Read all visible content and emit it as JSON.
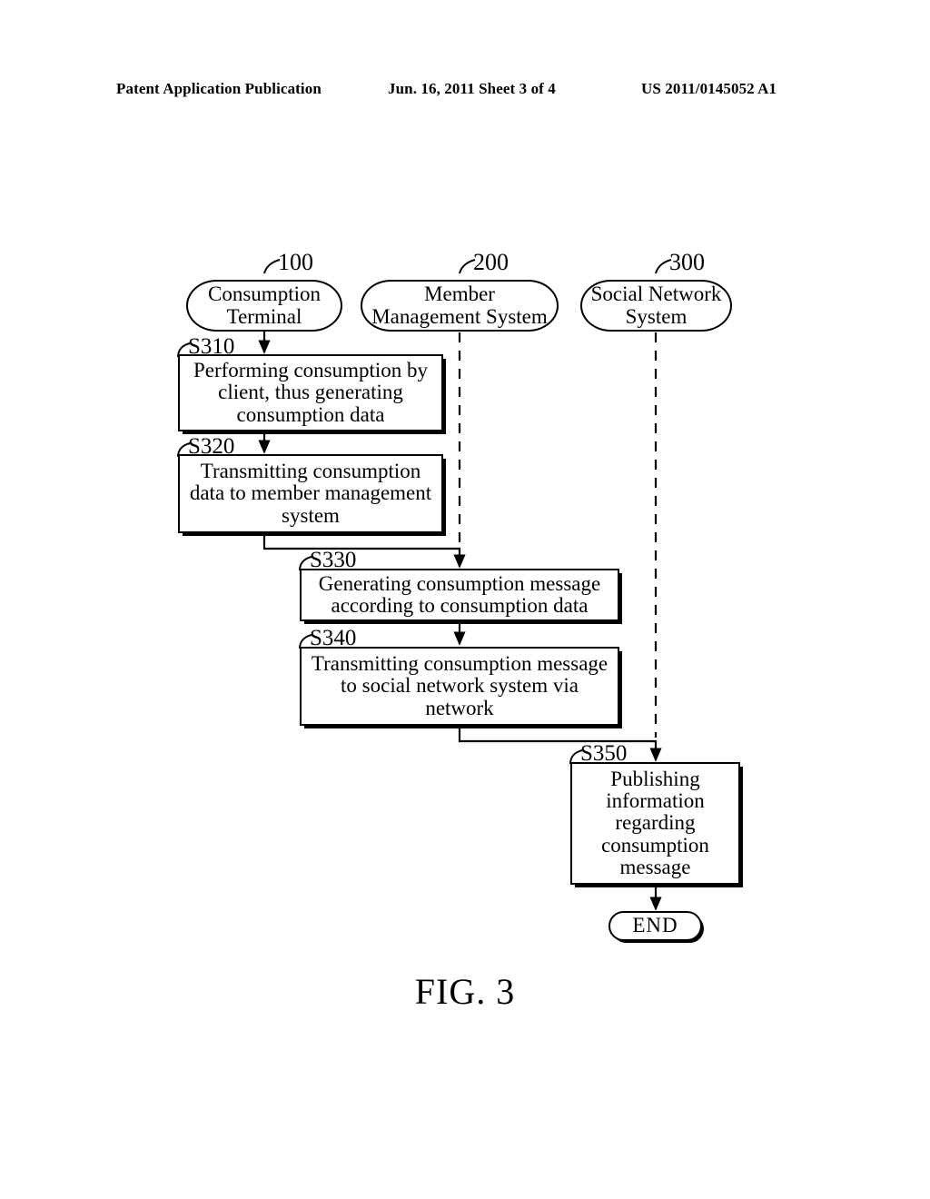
{
  "page_header": {
    "publication": "Patent Application Publication",
    "date_sheet": "Jun. 16, 2011  Sheet 3 of 4",
    "patent_number": "US 2011/0145052 A1"
  },
  "figure": {
    "caption": "FIG.  3"
  },
  "diagram": {
    "type": "swimlane-flowchart",
    "lanes": [
      {
        "id": "lane-consumption-terminal",
        "ref": "100",
        "label_line1": "Consumption",
        "label_line2": "Terminal"
      },
      {
        "id": "lane-member-management-system",
        "ref": "200",
        "label_line1": "Member",
        "label_line2": "Management System"
      },
      {
        "id": "lane-social-network-system",
        "ref": "300",
        "label_line1": "Social Network",
        "label_line2": "System"
      }
    ],
    "steps": [
      {
        "id": "step-s310",
        "tag": "S310",
        "lane": "lane-consumption-terminal",
        "text": "Performing consumption by client, thus generating consumption data"
      },
      {
        "id": "step-s320",
        "tag": "S320",
        "lane": "lane-consumption-terminal",
        "text": "Transmitting consumption data to member management system"
      },
      {
        "id": "step-s330",
        "tag": "S330",
        "lane": "lane-member-management-system",
        "text": "Generating consumption message according to consumption data"
      },
      {
        "id": "step-s340",
        "tag": "S340",
        "lane": "lane-member-management-system",
        "text": "Transmitting consumption message to social network system via network"
      },
      {
        "id": "step-s350",
        "tag": "S350",
        "lane": "lane-social-network-system",
        "text": "Publishing information regarding consumption message"
      }
    ],
    "terminator": {
      "id": "node-end",
      "label": "END"
    },
    "colors": {
      "stroke": "#000000",
      "fill": "#ffffff"
    }
  }
}
